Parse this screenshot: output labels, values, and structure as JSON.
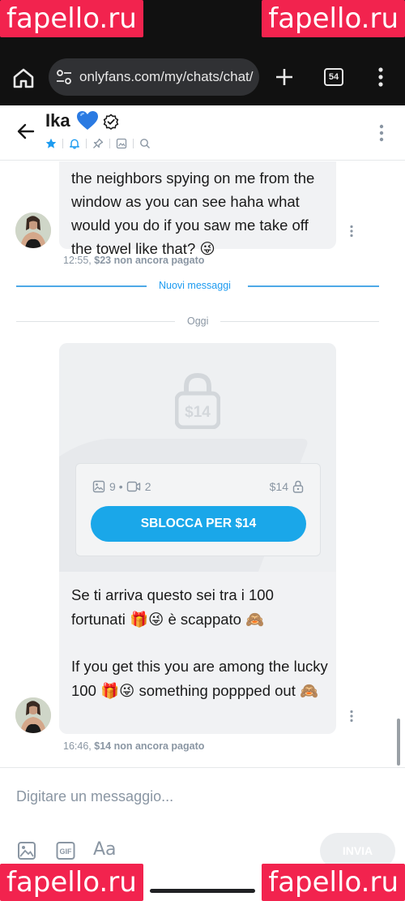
{
  "browser": {
    "url": "onlyfans.com/my/chats/chat/",
    "tab_count": "54"
  },
  "watermark": {
    "text": "fapello.ru"
  },
  "chat": {
    "name": "Ika",
    "emoji": "💙"
  },
  "messages": [
    {
      "text": "the neighbors spying on me from the window as you can see haha what would you do if you saw me take off the towel like that? 😜",
      "time": "12:55,",
      "status": "$23 non ancora pagato"
    },
    {
      "media": {
        "lock_price": "$14",
        "images": "9",
        "videos": "2",
        "price": "$14",
        "unlock_label": "SBLOCCA PER $14"
      },
      "text_it": "Se ti arriva questo sei tra i 100 fortunati 🎁😜 è scappato 🙈",
      "text_en": "If you get this you are among the lucky 100 🎁😜 something poppped out 🙈",
      "time": "16:46,",
      "status": "$14 non ancora pagato"
    }
  ],
  "dividers": {
    "new_messages": "Nuovi messaggi",
    "today": "Oggi"
  },
  "composer": {
    "placeholder": "Digitare un messaggio...",
    "format_label": "Aa",
    "send_label": "INVIA"
  },
  "colors": {
    "accent": "#1aa7e9",
    "watermark": "#f2234e",
    "muted": "#8a96a3",
    "bubble": "#f1f2f4"
  }
}
